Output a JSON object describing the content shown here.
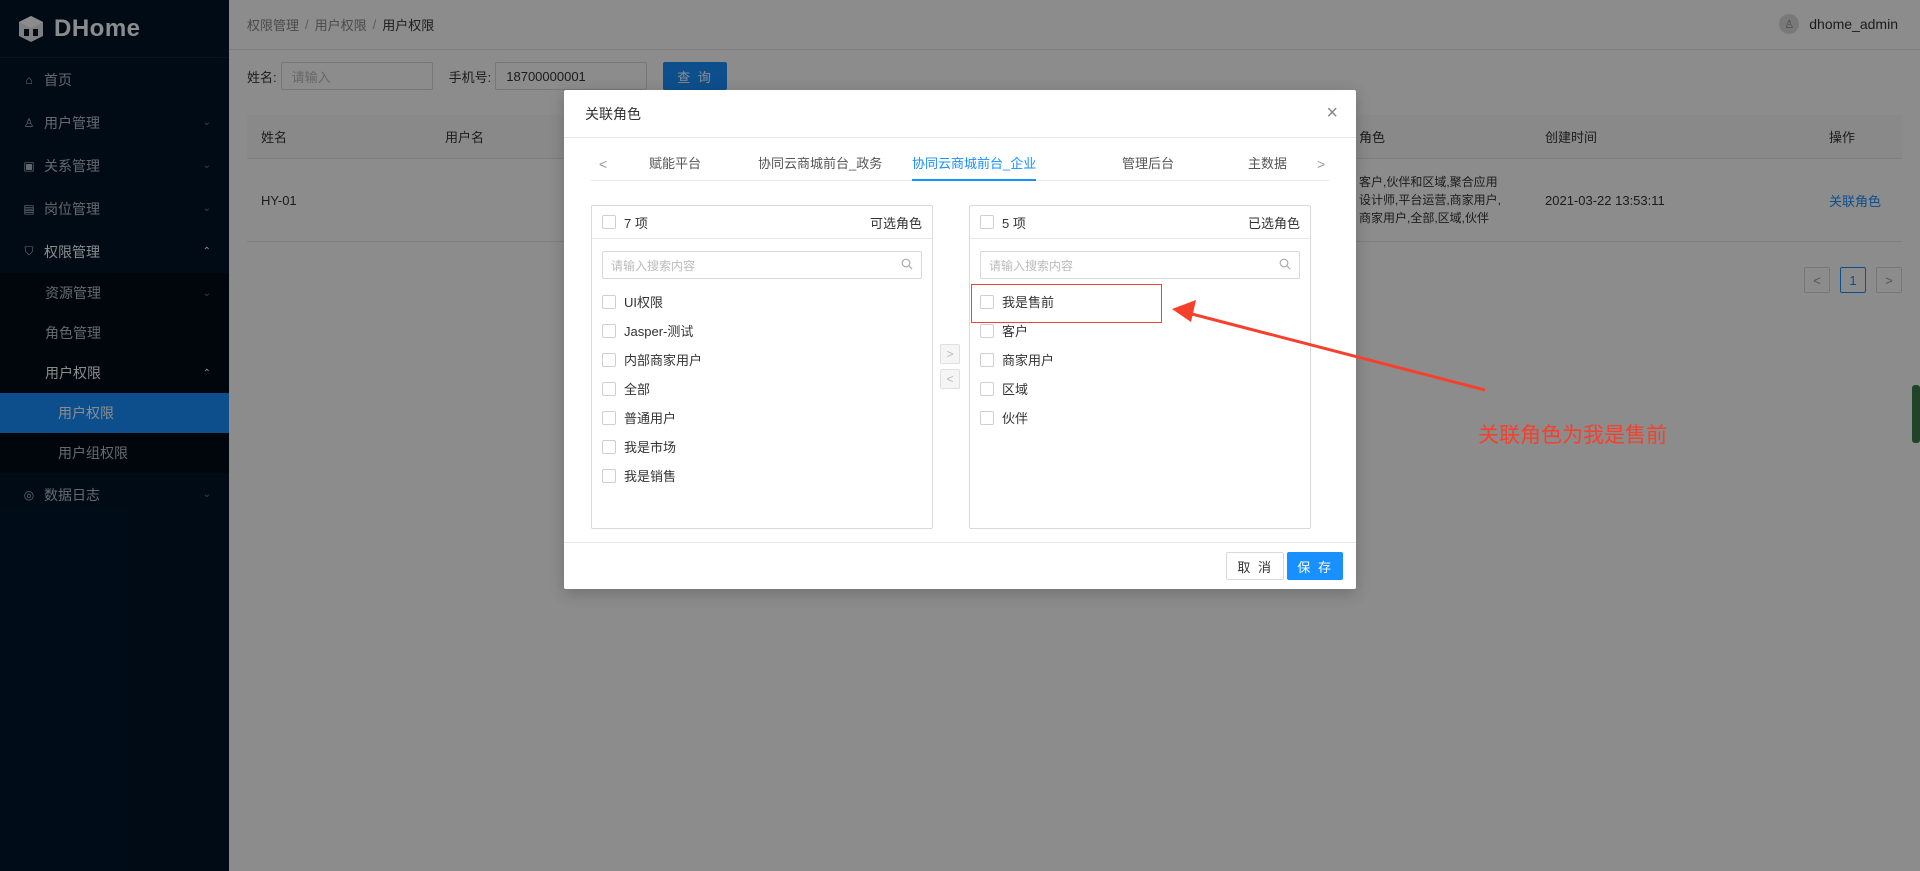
{
  "app": {
    "brand": "DHome"
  },
  "sidebar": {
    "items": [
      {
        "label": "首页",
        "icon": "home-icon",
        "arrow": ""
      },
      {
        "label": "用户管理",
        "icon": "user-icon",
        "arrow": "⌄"
      },
      {
        "label": "关系管理",
        "icon": "relation-icon",
        "arrow": "⌄"
      },
      {
        "label": "岗位管理",
        "icon": "post-icon",
        "arrow": "⌄"
      },
      {
        "label": "权限管理",
        "icon": "shield-icon",
        "arrow": "⌃"
      },
      {
        "label": "数据日志",
        "icon": "log-icon",
        "arrow": "⌄"
      }
    ],
    "sub": {
      "resource": "资源管理",
      "role": "角色管理",
      "user_perm": "用户权限",
      "user_perm_item": "用户权限",
      "group_perm_item": "用户组权限"
    }
  },
  "breadcrumb": [
    "权限管理",
    "用户权限",
    "用户权限"
  ],
  "breadcrumb_sep": "/",
  "user": {
    "name": "dhome_admin"
  },
  "filter": {
    "name_label": "姓名:",
    "name_placeholder": "请输入",
    "phone_label": "手机号:",
    "phone_value": "18700000001",
    "query_label": "查 询"
  },
  "table": {
    "headers": [
      "姓名",
      "用户名",
      "角色",
      "创建时间",
      "操作"
    ],
    "rows": [
      {
        "name": "HY-01",
        "roles_line1": "客户,伙伴和区域,聚合应用",
        "roles_line2": "设计师,平台运营,商家用户,",
        "roles_line3": "商家用户,全部,区域,伙伴",
        "created": "2021-03-22 13:53:11",
        "action": "关联角色"
      }
    ]
  },
  "pager": {
    "prev": "<",
    "current": "1",
    "next": ">"
  },
  "modal": {
    "title": "关联角色",
    "close": "×",
    "tabs": [
      "赋能平台",
      "协同云商城前台_政务",
      "协同云商城前台_企业",
      "管理后台",
      "主数据"
    ],
    "tab_prev": "<",
    "tab_next": ">",
    "left": {
      "count": "7 项",
      "title": "可选角色",
      "search_placeholder": "请输入搜索内容",
      "items": [
        "UI权限",
        "Jasper-测试",
        "内部商家用户",
        "全部",
        "普通用户",
        "我是市场",
        "我是销售"
      ]
    },
    "right": {
      "count": "5 项",
      "title": "已选角色",
      "search_placeholder": "请输入搜索内容",
      "items": [
        "我是售前",
        "客户",
        "商家用户",
        "区域",
        "伙伴"
      ]
    },
    "move_right": ">",
    "move_left": "<",
    "cancel": "取 消",
    "save": "保 存"
  },
  "annotation": {
    "text": "关联角色为我是售前",
    "color": "#f5412c"
  },
  "colors": {
    "sidebar": "#001529",
    "primary": "#1890ff",
    "annotation": "#f5412c"
  }
}
